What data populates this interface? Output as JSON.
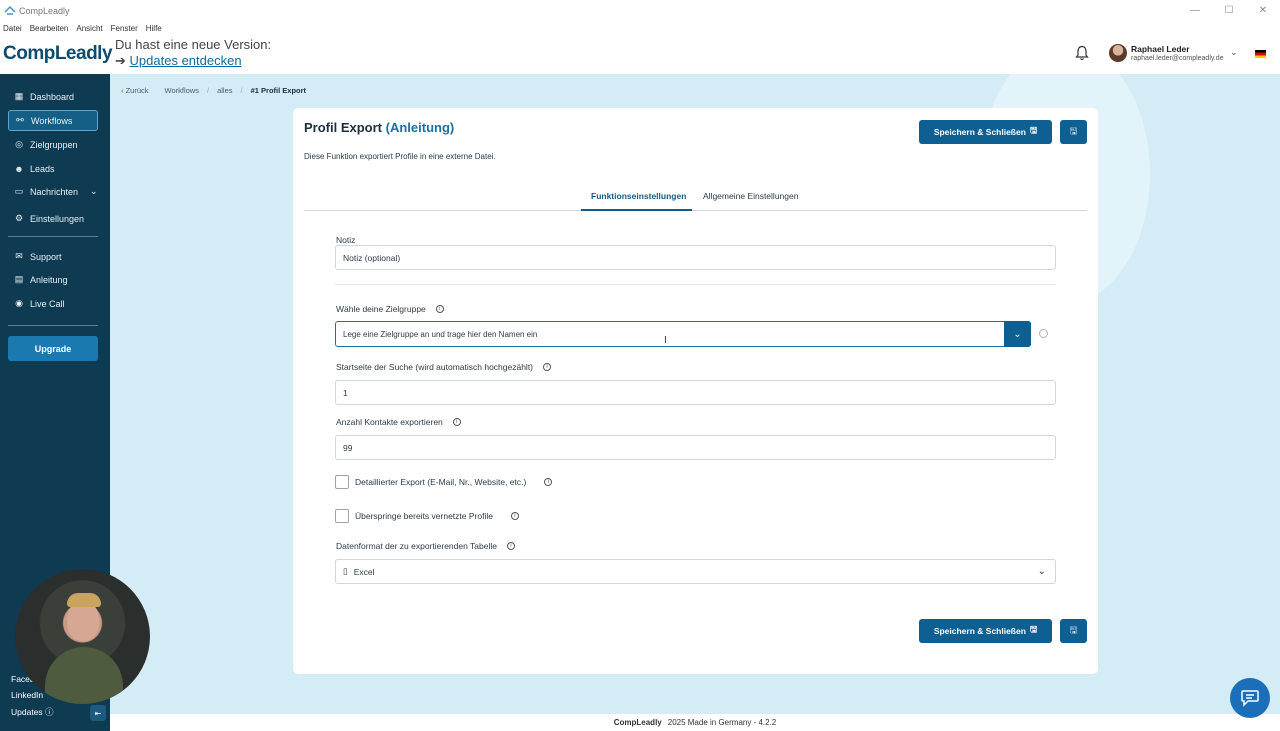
{
  "window": {
    "title": "CompLeadly"
  },
  "menu": [
    "Datei",
    "Bearbeiten",
    "Ansicht",
    "Fenster",
    "Hilfe"
  ],
  "header": {
    "logo": "CompLeadly",
    "update_line1": "Du hast eine neue Version:",
    "update_arrow": "➔",
    "update_link": "Updates entdecken",
    "user_name": "Raphael Leder",
    "user_email": "raphael.leder@compleadly.de"
  },
  "sidebar": {
    "items": [
      {
        "label": "Dashboard",
        "icon": "dashboard-icon"
      },
      {
        "label": "Workflows",
        "icon": "workflow-icon"
      },
      {
        "label": "Zielgruppen",
        "icon": "target-icon"
      },
      {
        "label": "Leads",
        "icon": "users-icon"
      },
      {
        "label": "Nachrichten",
        "icon": "chat-icon"
      },
      {
        "label": "Einstellungen",
        "icon": "gear-icon"
      },
      {
        "label": "Support",
        "icon": "support-icon"
      },
      {
        "label": "Anleitung",
        "icon": "book-icon"
      },
      {
        "label": "Live Call",
        "icon": "camera-icon"
      }
    ],
    "upgrade": "Upgrade",
    "footer_links": [
      "Faceb",
      "LinkedIn",
      "Updates"
    ]
  },
  "breadcrumb": {
    "back": "Zurück",
    "items": [
      "Workflows",
      "alles",
      "#1 Profil Export"
    ]
  },
  "card": {
    "title": "Profil Export",
    "title_link": "(Anleitung)",
    "description": "Diese Funktion exportiert Profile in eine externe Datei.",
    "save_close": "Speichern & Schließen",
    "tabs": [
      "Funktionseinstellungen",
      "Allgemeine Einstellungen"
    ],
    "fields": {
      "note_label": "Notiz",
      "note_placeholder": "Notiz (optional)",
      "audience_label": "Wähle deine Zielgruppe",
      "audience_placeholder": "Lege eine Zielgruppe an und trage hier den Namen ein",
      "start_label": "Startseite der Suche (wird automatisch hochgezählt)",
      "start_value": "1",
      "count_label": "Anzahl Kontakte exportieren",
      "count_value": "99",
      "detailed_label": "Detaillierter Export (E-Mail, Nr., Website, etc.)",
      "skip_label": "Überspringe bereits vernetzte Profile",
      "format_label": "Datenformat der zu exportierenden Tabelle",
      "format_value": "Excel"
    }
  },
  "footer": {
    "brand": "CompLeadly",
    "text": "2025 Made in Germany - 4.2.2"
  },
  "colors": {
    "sidebar": "#0e3a52",
    "primary": "#0e5f92",
    "background": "#d4ecf6"
  }
}
